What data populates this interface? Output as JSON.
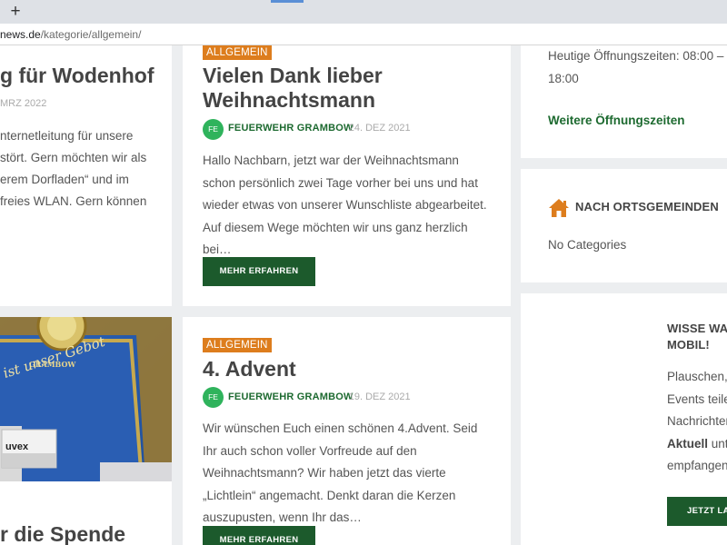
{
  "browser": {
    "new_tab_glyph": "+",
    "url_domain": "news.de",
    "url_path": "/kategorie/allgemein/"
  },
  "left_column": {
    "post_title": "g für Wodenhof",
    "post_date": "MRZ 2022",
    "excerpt_lines": [
      "nternetleitung für unsere",
      "stört. Gern möchten wir als",
      "erem Dorfladen“ und im",
      "freies WLAN. Gern können"
    ],
    "bottom_title": "r die Spende",
    "photo_text": "ist unser Gebot",
    "photo_seal_text": "GRAMBOW",
    "photo_box_label": "uvex"
  },
  "posts": [
    {
      "category": "ALLGEMEIN",
      "title_lines": [
        "Vielen Dank lieber",
        "Weihnachtsmann"
      ],
      "avatar_initials": "FE",
      "author": "FEUERWEHR GRAMBOW",
      "date": "24. DEZ 2021",
      "excerpt": "Hallo Nachbarn, jetzt war der Weihnachtsmann schon persönlich zwei Tage vorher bei uns und hat wieder etwas von unserer Wunschliste abgearbeitet. Auf diesem Wege möchten wir uns ganz herzlich bei…",
      "button": "MEHR ERFAHREN"
    },
    {
      "category": "ALLGEMEIN",
      "title_lines": [
        "4. Advent"
      ],
      "avatar_initials": "FE",
      "author": "FEUERWEHR GRAMBOW",
      "date": "19. DEZ 2021",
      "excerpt": "Wir wünschen Euch einen schönen 4.Advent. Seid Ihr auch schon voller Vorfreude auf den Weihnachtsmann? Wir haben jetzt das vierte „Lichtlein“ angemacht. Denkt daran die Kerzen auszupusten, wenn Ihr das…",
      "button": "MEHR ERFAHREN"
    }
  ],
  "sidebar": {
    "hours_line1": "Heutige Öffnungszeiten: 08:00 –",
    "hours_line2": "18:00",
    "hours_link": "Weitere Öffnungszeiten",
    "villages_heading": "NACH ORTSGEMEINDEN",
    "villages_empty": "No Categories",
    "app_heading_line1": "WISSE WA",
    "app_heading_line2": "MOBIL!",
    "app_text_lines": [
      "Plauschen,",
      "Events teile",
      "Nachrichter"
    ],
    "app_bold": "Aktuell",
    "app_text_after_bold": " unt",
    "app_text_last": "empfangen",
    "app_button": "JETZT LAD"
  },
  "colors": {
    "accent_orange": "#dd7d1d",
    "brand_green": "#1d6a30",
    "button_green": "#1c5a2c",
    "avatar_green": "#2fb35c"
  }
}
